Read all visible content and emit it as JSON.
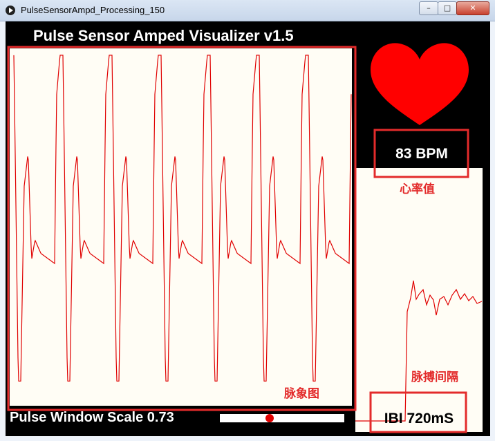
{
  "window": {
    "title": "PulseSensorAmpd_Processing_150",
    "minimize_label": "–",
    "maximize_label": "□",
    "close_label": "✕"
  },
  "app": {
    "heading": "Pulse Sensor Amped Visualizer v1.5",
    "bpm_readout": "83 BPM",
    "ibi_readout": "IBI 720mS",
    "scale_label": "Pulse Window Scale 0.73",
    "scale_value": 0.73
  },
  "annotations": {
    "heart_rate": "心率值",
    "pulse_waveform": "脉象图",
    "beat_interval": "脉搏间隔"
  },
  "colors": {
    "background": "#000000",
    "panel": "#fffdf5",
    "trace": "#e00000",
    "heart": "#ff0000",
    "annotation": "#e32b2b"
  }
}
